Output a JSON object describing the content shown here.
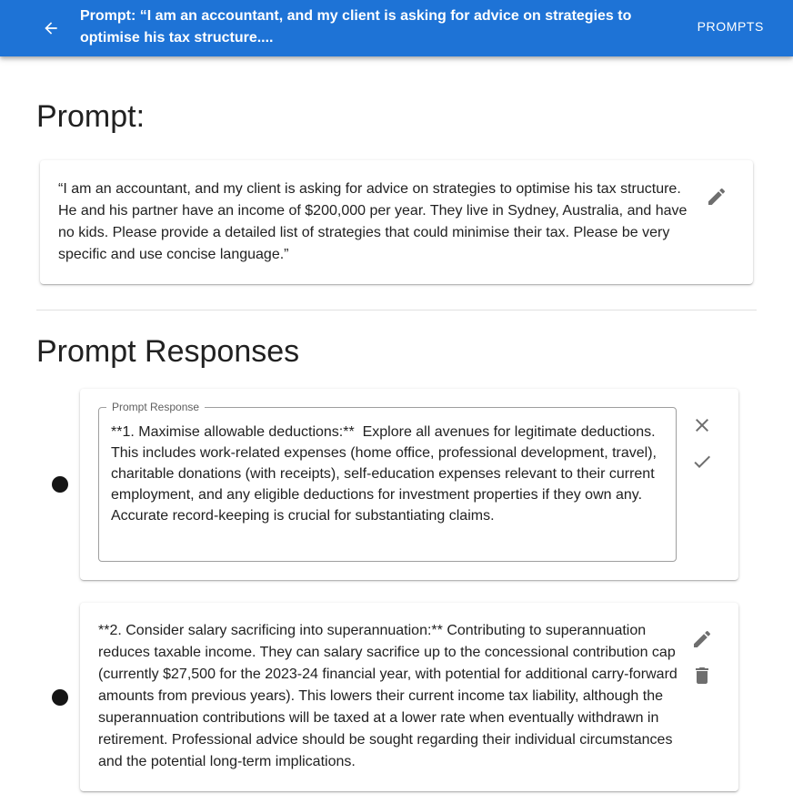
{
  "appbar": {
    "title": "Prompt: “I am an accountant, and my client is asking for advice on strategies to optimise his tax structure....",
    "prompts_link": "PROMPTS",
    "color": "#1e73d6"
  },
  "prompt_section": {
    "heading": "Prompt:",
    "text": "“I am an accountant, and my client is asking for advice on strategies to optimise his tax structure. He and his partner have an income of $200,000 per year. They live in Sydney, Australia, and have no kids. Please provide a detailed list of strategies that could minimise their tax. Please be very specific and use concise language.”"
  },
  "responses_section": {
    "heading": "Prompt Responses",
    "items": [
      {
        "field_label": "Prompt Response",
        "text": "**1. Maximise allowable deductions:**  Explore all avenues for legitimate deductions. This includes work-related expenses (home office, professional development, travel), charitable donations (with receipts), self-education expenses relevant to their current employment, and any eligible deductions for investment properties if they own any.  Accurate record-keeping is crucial for substantiating claims."
      },
      {
        "text": "**2. Consider salary sacrificing into superannuation:** Contributing to superannuation reduces taxable income. They can salary sacrifice up to the concessional contribution cap (currently $27,500 for the 2023-24 financial year, with potential for additional carry-forward amounts from previous years). This lowers their current income tax liability, although the superannuation contributions will be taxed at a lower rate when eventually withdrawn in retirement. Professional advice should be sought regarding their individual circumstances and the potential long-term implications."
      }
    ]
  },
  "icons": {
    "back": "arrow-back-icon",
    "edit": "pencil-icon",
    "cancel": "close-icon",
    "save": "check-icon",
    "delete": "trash-icon"
  }
}
